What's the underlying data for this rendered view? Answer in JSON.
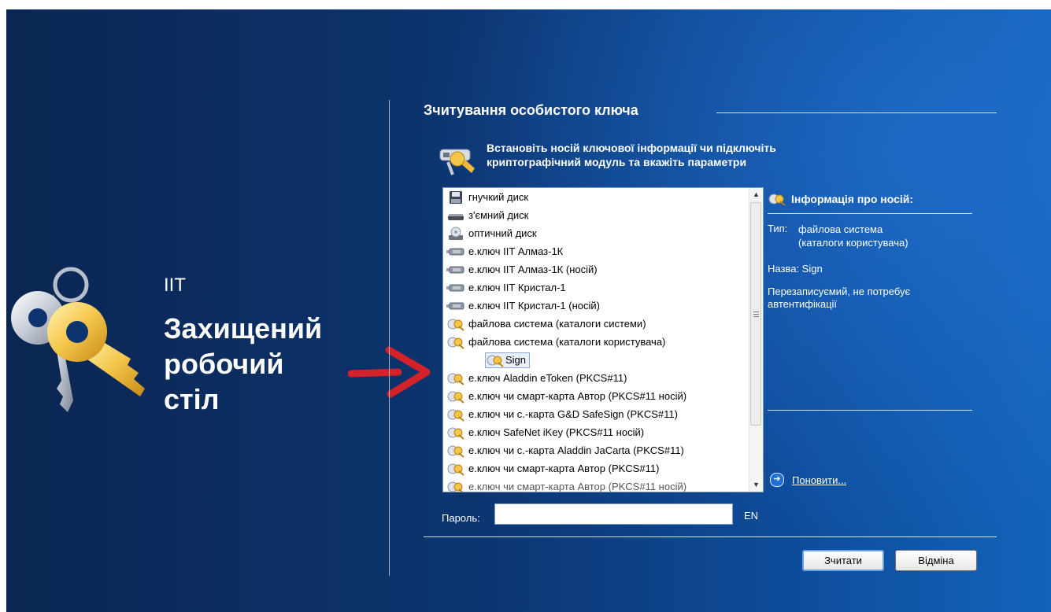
{
  "brand": {
    "prefix": "ІІТ",
    "name_lines": [
      "Захищений",
      "робочий",
      "стіл"
    ]
  },
  "dialog": {
    "title": "Зчитування особистого ключа",
    "instruction_lines": [
      "Встановіть носій ключової інформації чи підключіть",
      "криптографічний модуль та вкажіть параметри"
    ]
  },
  "media_list": {
    "items": [
      {
        "label": "гнучкий диск",
        "icon": "floppy-drive-icon"
      },
      {
        "label": "з'ємний диск",
        "icon": "removable-drive-icon"
      },
      {
        "label": "оптичний диск",
        "icon": "optical-drive-icon"
      },
      {
        "label": "е.ключ ІІТ Алмаз-1К",
        "icon": "usb-key-icon"
      },
      {
        "label": "е.ключ ІІТ Алмаз-1К (носій)",
        "icon": "usb-key-icon"
      },
      {
        "label": "е.ключ ІІТ Кристал-1",
        "icon": "usb-key-icon"
      },
      {
        "label": "е.ключ ІІТ Кристал-1 (носій)",
        "icon": "usb-key-icon"
      },
      {
        "label": "файлова система (каталоги системи)",
        "icon": "key-tag-icon"
      },
      {
        "label": "файлова система (каталоги користувача)",
        "icon": "key-tag-icon"
      },
      {
        "label": "Sign",
        "icon": "key-tag-icon",
        "child": true,
        "selected": true
      },
      {
        "label": "е.ключ Aladdin eToken (PKCS#11)",
        "icon": "key-tag-icon"
      },
      {
        "label": "е.ключ чи смарт-карта Автор (PKCS#11 носій)",
        "icon": "key-tag-icon"
      },
      {
        "label": "е.ключ чи с.-карта G&D SafeSign (PKCS#11)",
        "icon": "key-tag-icon"
      },
      {
        "label": "е.ключ SafeNet iKey (PKCS#11 носій)",
        "icon": "key-tag-icon"
      },
      {
        "label": "е.ключ чи с.-карта Aladdin JaCarta (PKCS#11)",
        "icon": "key-tag-icon"
      },
      {
        "label": "е.ключ чи смарт-карта Автор (PKCS#11)",
        "icon": "key-tag-icon"
      },
      {
        "label": "е.ключ чи смарт-карта Автор (PKCS#11 носій)",
        "icon": "key-tag-icon",
        "cut": true
      }
    ]
  },
  "info_panel": {
    "heading": "Інформація про носій:",
    "type_label": "Тип:",
    "type_value_lines": [
      "файлова система",
      "(каталоги користувача)"
    ],
    "name_label": "Назва:",
    "name_value": "Sign",
    "description_lines": [
      "Перезаписуємий, не потребує",
      "автентифікації"
    ],
    "refresh_label": "Поновити..."
  },
  "password": {
    "label": "Пароль:",
    "value": "",
    "layout_indicator": "EN"
  },
  "buttons": {
    "read": "Зчитати",
    "cancel": "Відміна"
  },
  "colors": {
    "background": "#0c3570",
    "accent": "#1363bb",
    "arrow": "#d4222a"
  }
}
